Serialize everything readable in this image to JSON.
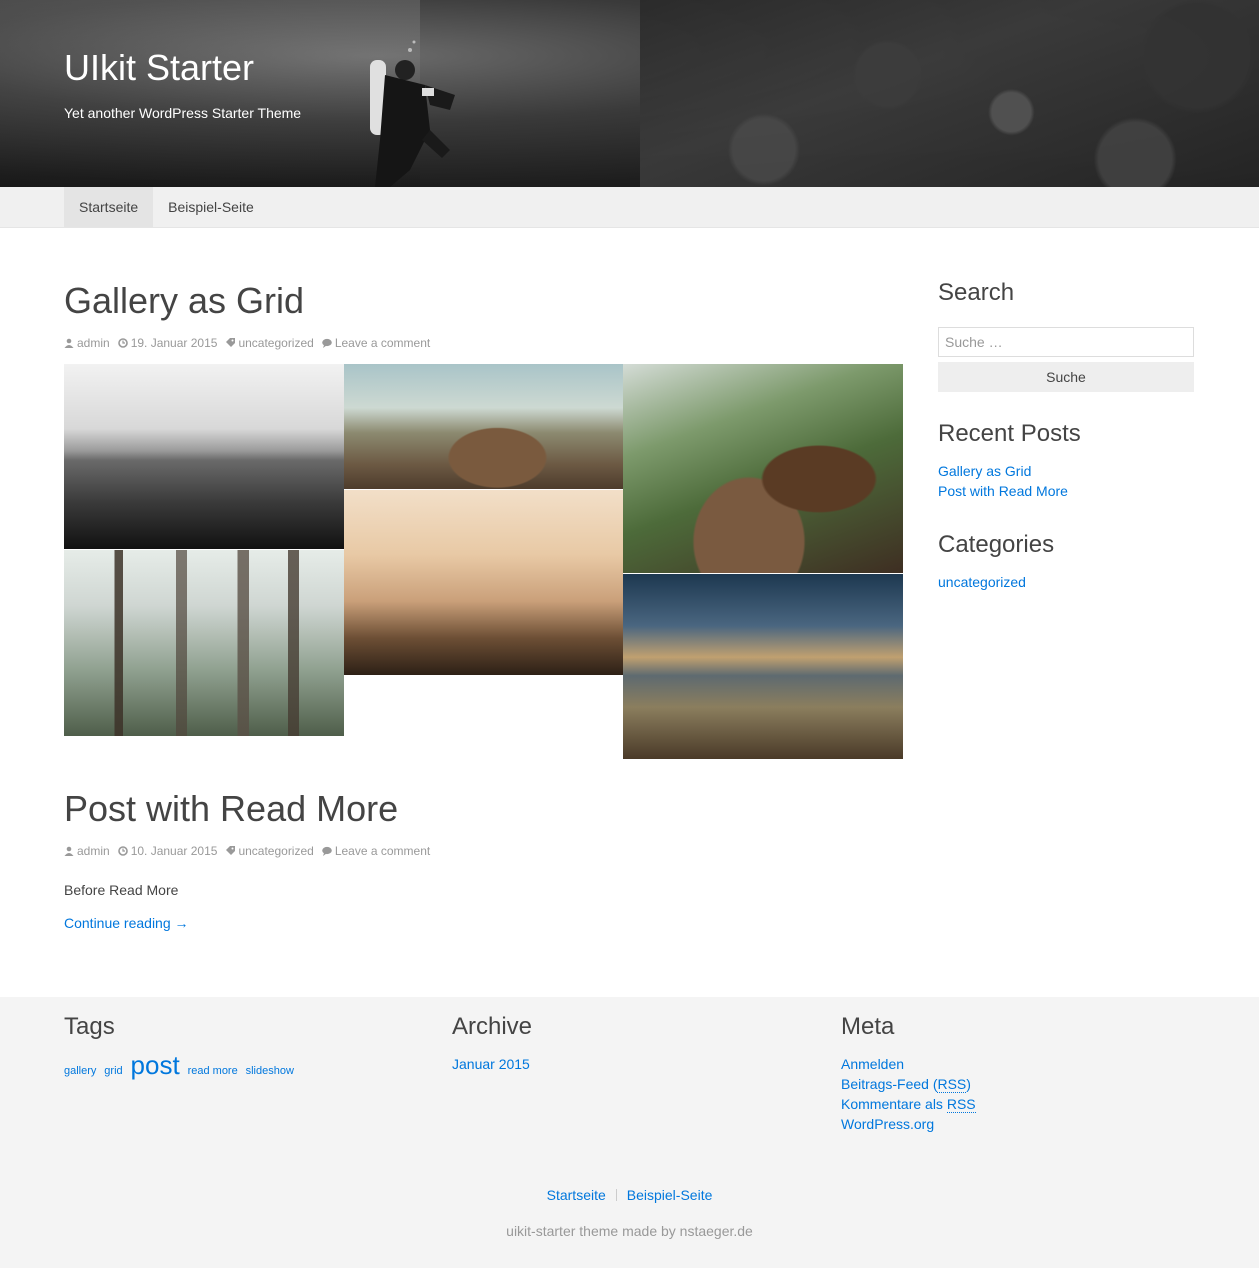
{
  "site": {
    "title": "UIkit Starter",
    "tagline": "Yet another WordPress Starter Theme"
  },
  "nav": {
    "items": [
      "Startseite",
      "Beispiel-Seite"
    ],
    "active": "Startseite"
  },
  "posts": [
    {
      "title": "Gallery as Grid",
      "author": "admin",
      "date": "19. Januar 2015",
      "category": "uncategorized",
      "comments": "Leave a comment"
    },
    {
      "title": "Post with Read More",
      "author": "admin",
      "date": "10. Januar 2015",
      "category": "uncategorized",
      "comments": "Leave a comment",
      "excerpt": "Before Read More",
      "more": "Continue reading →"
    }
  ],
  "sidebar": {
    "search": {
      "title": "Search",
      "placeholder": "Suche …",
      "button": "Suche"
    },
    "recent": {
      "title": "Recent Posts",
      "items": [
        "Gallery as Grid",
        "Post with Read More"
      ]
    },
    "categories": {
      "title": "Categories",
      "items": [
        "uncategorized"
      ]
    }
  },
  "footer": {
    "tags": {
      "title": "Tags",
      "items": [
        "gallery",
        "grid",
        "post",
        "read more",
        "slideshow"
      ]
    },
    "archive": {
      "title": "Archive",
      "items": [
        "Januar 2015"
      ]
    },
    "meta": {
      "title": "Meta",
      "login": "Anmelden",
      "feed_prefix": "Beitrags-Feed (",
      "feed_abbr": "RSS",
      "feed_suffix": ")",
      "comments_prefix": "Kommentare als ",
      "comments_abbr": "RSS",
      "wordpress": "WordPress.org"
    },
    "nav": [
      "Startseite",
      "Beispiel-Seite"
    ],
    "credit": "uikit-starter theme made by nstaeger.de"
  },
  "colors": {
    "link": "#0077dd",
    "text": "#444444",
    "meta": "#999999",
    "nav_bg": "#f0f0f0",
    "footer_bg": "#f4f4f4"
  }
}
